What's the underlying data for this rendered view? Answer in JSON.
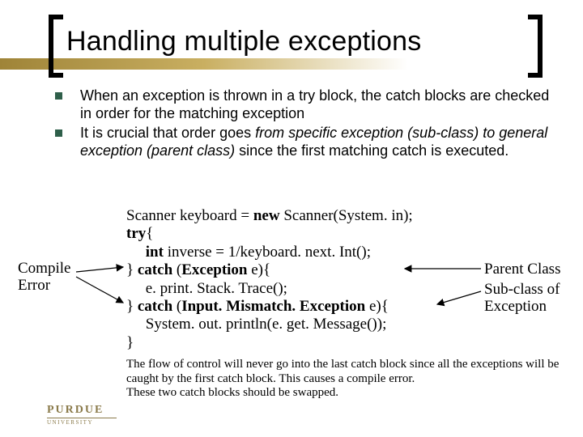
{
  "title": "Handling multiple exceptions",
  "bullets": {
    "b1": "When an exception is thrown in a try block, the catch blocks are checked in order for the matching exception",
    "b2_pre": "It is crucial that order goes ",
    "b2_em": "from specific exception (sub-class) to general exception (parent class)",
    "b2_post": " since the first matching catch is executed."
  },
  "code": {
    "l1a": "Scanner keyboard = ",
    "l1b": "new",
    "l1c": " Scanner(System. in);",
    "l2a": "try",
    "l2b": "{",
    "l3a": "     ",
    "l3b": "int",
    "l3c": " inverse = 1/keyboard. next. Int();",
    "l4a": "} ",
    "l4b": "catch",
    "l4c": " (",
    "l4d": "Exception",
    "l4e": " e){",
    "l5": "     e. print. Stack. Trace();",
    "l6a": "} ",
    "l6b": "catch",
    "l6c": " (",
    "l6d": "Input. Mismatch. Exception",
    "l6e": " e){",
    "l7": "     System. out. println(e. get. Message());",
    "l8": "}"
  },
  "labels": {
    "compile_error_a": "Compile",
    "compile_error_b": "Error",
    "parent_class": "Parent Class",
    "subclass_a": "Sub-class of",
    "subclass_b": "Exception"
  },
  "note": {
    "n1": "The flow of control will never go into the last catch block since all the exceptions will be caught by the first catch block. This causes a compile error.",
    "n2": "These two catch blocks should be swapped."
  },
  "logo": {
    "top": "PURDUE",
    "bottom": "UNIVERSITY"
  }
}
